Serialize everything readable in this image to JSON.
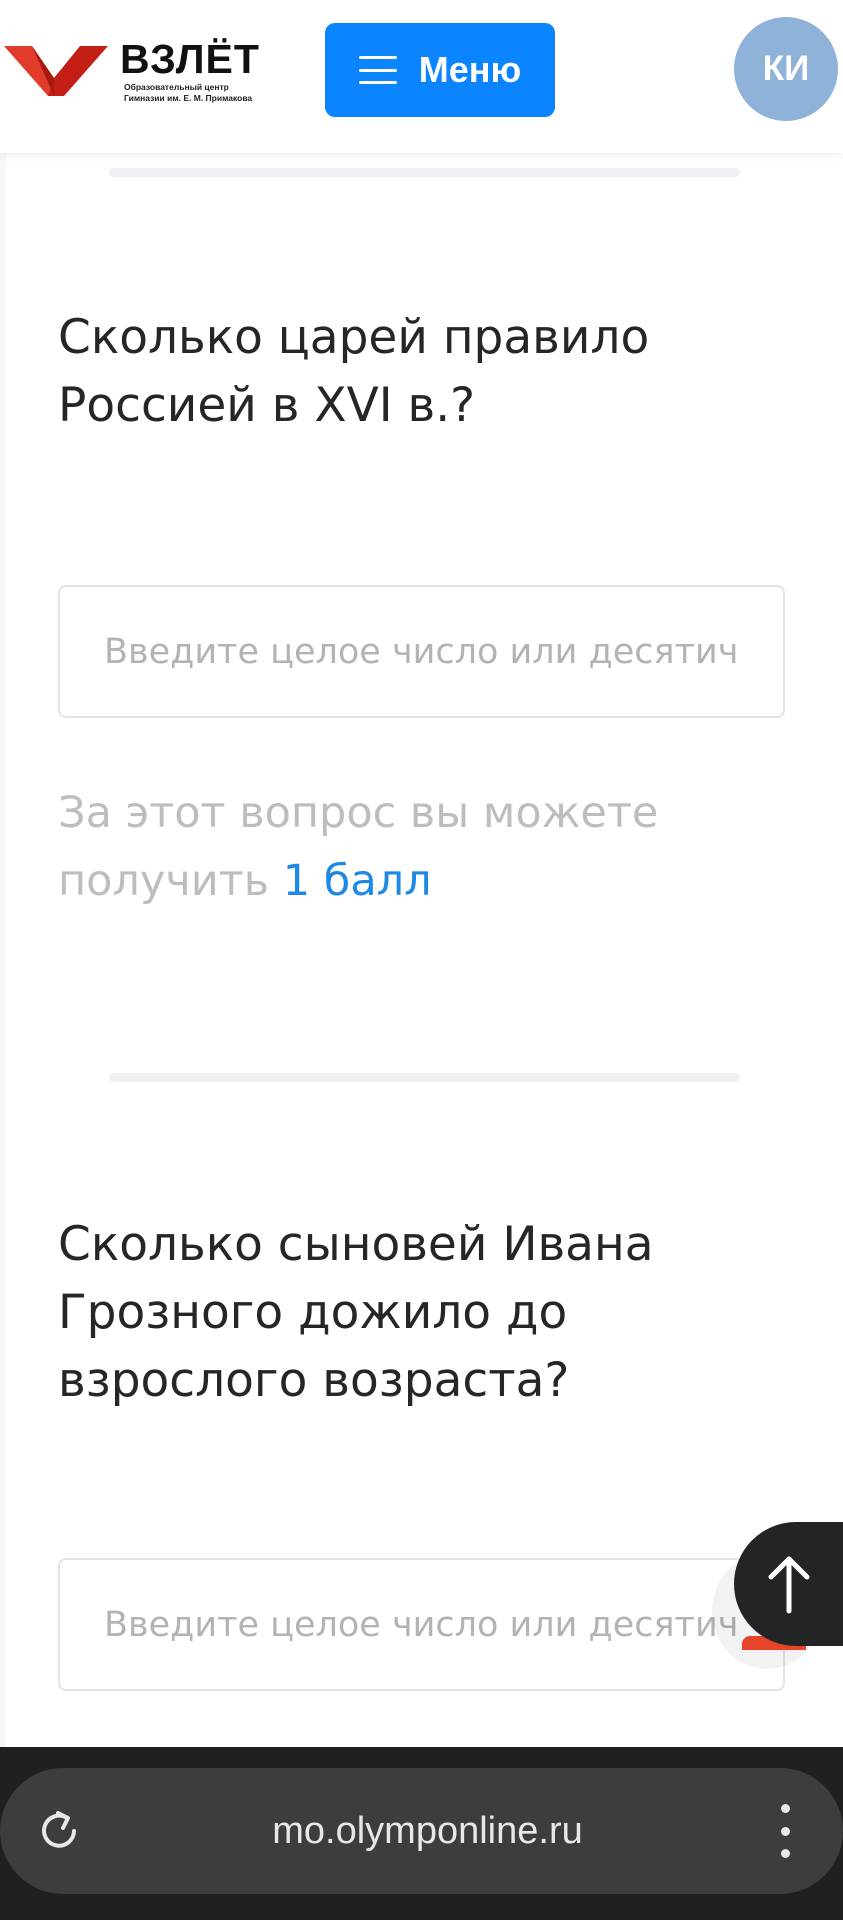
{
  "header": {
    "logo_title": "ВЗЛЁТ",
    "logo_subtitle_line1": "Образовательный центр",
    "logo_subtitle_line2": "Гимназии им. Е. М. Примакова",
    "menu_label": "Меню",
    "avatar_initials": "КИ"
  },
  "questions": [
    {
      "text": "Сколько царей правило Россией в XVI в.?",
      "input_placeholder": "Введите целое число или десятичную дробь",
      "points_prefix": "За этот вопрос вы можете получить",
      "points_value": "1 балл"
    },
    {
      "text": "Сколько сыновей Ивана Грозного дожило до взрослого возраста?",
      "input_placeholder": "Введите целое число или десятичную дробь"
    }
  ],
  "browser": {
    "url": "mo.olymponline.ru"
  },
  "colors": {
    "brand_red": "#d9261c",
    "menu_blue": "#0a84ff",
    "avatar": "#8fb2d9",
    "points_link": "#1e88e5"
  },
  "icons": {
    "menu": "hamburger-icon",
    "scroll_top": "arrow-up-icon",
    "reload": "reload-icon",
    "more": "more-vertical-icon"
  }
}
